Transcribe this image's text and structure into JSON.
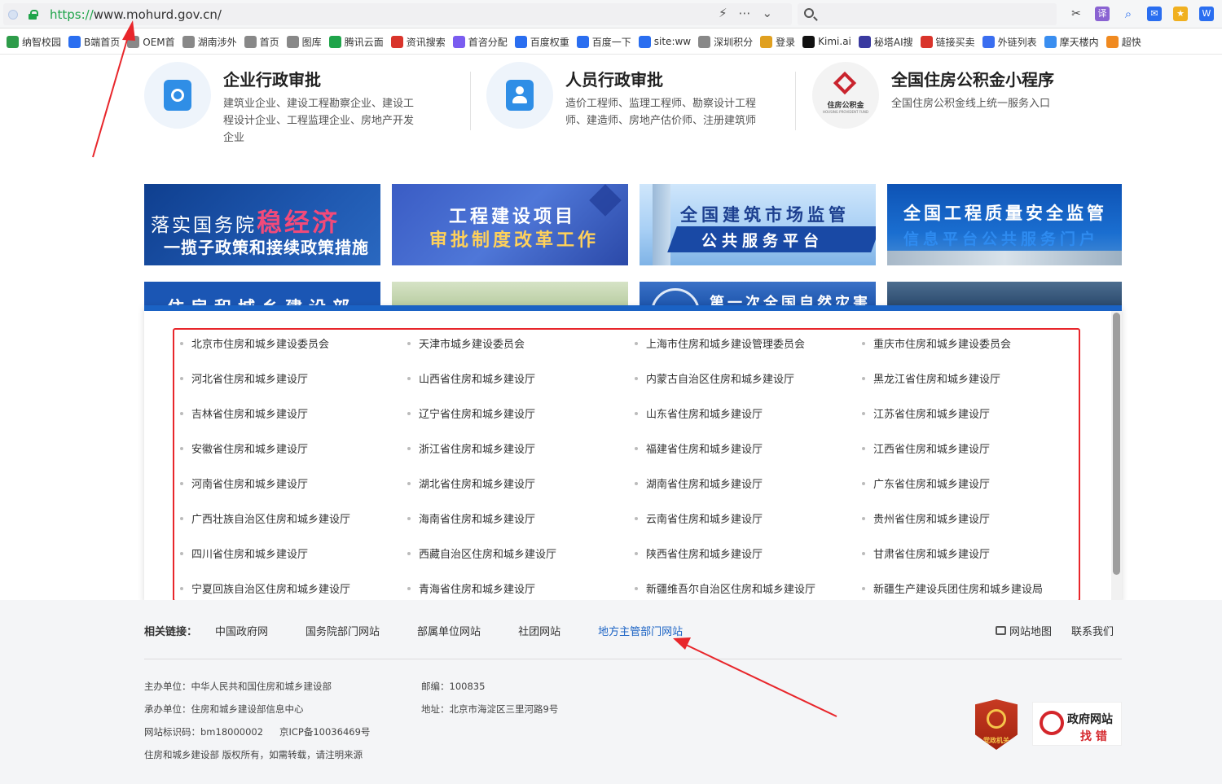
{
  "browser": {
    "url_proto": "https://",
    "url_rest": "www.mohurd.gov.cn/",
    "bookmarks": [
      {
        "label": "纳智校园",
        "color": "#2e9c4a"
      },
      {
        "label": "B端首页",
        "color": "#2a6ef0"
      },
      {
        "label": "OEM首",
        "color": "#888888"
      },
      {
        "label": "湖南涉外",
        "color": "#888888"
      },
      {
        "label": "首页",
        "color": "#888888"
      },
      {
        "label": "图库",
        "color": "#888888"
      },
      {
        "label": "腾讯云面",
        "color": "#1fa44a"
      },
      {
        "label": "资讯搜索",
        "color": "#d9342b"
      },
      {
        "label": "首咨分配",
        "color": "#7a5cf0"
      },
      {
        "label": "百度权重",
        "color": "#2a6ef0"
      },
      {
        "label": "百度一下",
        "color": "#2a6ef0"
      },
      {
        "label": "site:ww",
        "color": "#2a6ef0"
      },
      {
        "label": "深圳积分",
        "color": "#888888"
      },
      {
        "label": "登录",
        "color": "#e0a020"
      },
      {
        "label": "Kimi.ai",
        "color": "#111111"
      },
      {
        "label": "秘塔AI搜",
        "color": "#3a3aa0"
      },
      {
        "label": "链接买卖",
        "color": "#d9342b"
      },
      {
        "label": "外链列表",
        "color": "#3a6ef0"
      },
      {
        "label": "摩天楼内",
        "color": "#3a8ef0"
      },
      {
        "label": "超快",
        "color": "#f08a20"
      }
    ]
  },
  "services": [
    {
      "title": "企业行政审批",
      "desc": "建筑业企业、建设工程勘察企业、建设工程设计企业、工程监理企业、房地产开发企业"
    },
    {
      "title": "人员行政审批",
      "desc": "造价工程师、监理工程师、勘察设计工程师、建造师、房地产估价师、注册建筑师"
    },
    {
      "title": "全国住房公积金小程序",
      "desc": "全国住房公积金线上统一服务入口",
      "logo_text": "住房公积金",
      "logo_sub": "HOUSING PROVIDENT FUND"
    }
  ],
  "banners": {
    "b1_l1": "落实国务院",
    "b1_hl": "稳经济",
    "b1_l2": "一揽子政策和接续政策措施",
    "b2_l1": "工程建设项目",
    "b2_l2": "审批制度改革工作",
    "b3_l1": "全国建筑市场监管",
    "b3_l2": "公共服务平台",
    "b4_l1": "全国工程质量安全监管",
    "b4_l2": "信息平台公共服务门户",
    "c1": "住房和城乡建设部",
    "c3": "第一次全国自然灾害"
  },
  "local_depts": [
    "北京市住房和城乡建设委员会",
    "天津市城乡建设委员会",
    "上海市住房和城乡建设管理委员会",
    "重庆市住房和城乡建设委员会",
    "河北省住房和城乡建设厅",
    "山西省住房和城乡建设厅",
    "内蒙古自治区住房和城乡建设厅",
    "黑龙江省住房和城乡建设厅",
    "吉林省住房和城乡建设厅",
    "辽宁省住房和城乡建设厅",
    "山东省住房和城乡建设厅",
    "江苏省住房和城乡建设厅",
    "安徽省住房和城乡建设厅",
    "浙江省住房和城乡建设厅",
    "福建省住房和城乡建设厅",
    "江西省住房和城乡建设厅",
    "河南省住房和城乡建设厅",
    "湖北省住房和城乡建设厅",
    "湖南省住房和城乡建设厅",
    "广东省住房和城乡建设厅",
    "广西壮族自治区住房和城乡建设厅",
    "海南省住房和城乡建设厅",
    "云南省住房和城乡建设厅",
    "贵州省住房和城乡建设厅",
    "四川省住房和城乡建设厅",
    "西藏自治区住房和城乡建设厅",
    "陕西省住房和城乡建设厅",
    "甘肃省住房和城乡建设厅",
    "宁夏回族自治区住房和城乡建设厅",
    "青海省住房和城乡建设厅",
    "新疆维吾尔自治区住房和城乡建设厅",
    "新疆生产建设兵团住房和城乡建设局"
  ],
  "footer": {
    "related_label": "相关链接：",
    "links": [
      "中国政府网",
      "国务院部门网站",
      "部属单位网站",
      "社团网站",
      "地方主管部门网站"
    ],
    "sitemap": "网站地图",
    "contact": "联系我们",
    "sponsor": "主办单位：中华人民共和国住房和城乡建设部",
    "undertaker": "承办单位：住房和城乡建设部信息中心",
    "site_id": "网站标识码：bm18000002",
    "icp": "京ICP备10036469号",
    "copyright": "住房和城乡建设部 版权所有，如需转载，请注明来源",
    "postcode": "邮编：100835",
    "address": "地址：北京市海淀区三里河路9号",
    "badge1": "党政机关",
    "badge2_l1": "政府网站",
    "badge2_l2": "找 错"
  },
  "colors": {
    "accent": "#1a62c4",
    "annotation": "#e8262b"
  }
}
